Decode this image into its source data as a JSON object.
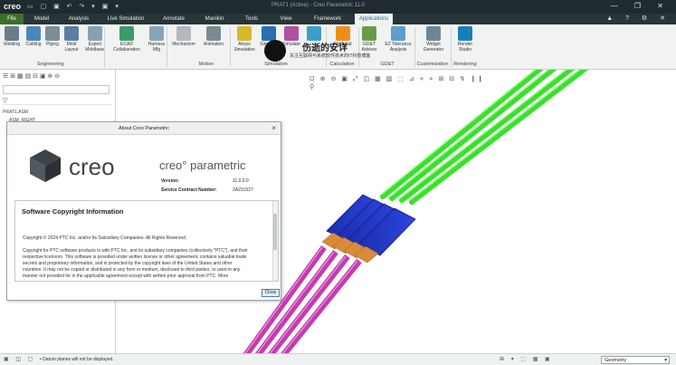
{
  "titlebar": {
    "logo": "creo",
    "window_title": "PRAT1 (Active) - Creo Parametric 11.0",
    "quick_access": "▭ ▢ ▣ ↶ ↷ ▾ ▣ ▾"
  },
  "menu": {
    "tabs": [
      "File",
      "Model",
      "Analysis",
      "Live Simulation",
      "Annotate",
      "Manikin",
      "Tools",
      "View",
      "Framework",
      "Applications"
    ],
    "active": "Applications",
    "help_icons": "▲ ? ⚙ ✕"
  },
  "ribbon": {
    "buttons": [
      {
        "label": "Welding",
        "color": "#6b7c8a"
      },
      {
        "label": "Cabling",
        "color": "#4c86b8"
      },
      {
        "label": "Piping",
        "color": "#7a8e98"
      },
      {
        "label": "Mold\nLayout",
        "color": "#5a7fa3"
      },
      {
        "label": "Expert\nMoldbase",
        "color": "#8aa0b0"
      },
      {
        "label": "ECAD\nCollaboration",
        "color": "#3f9a6a"
      },
      {
        "label": "Harness\nMfg",
        "color": "#88a3b8"
      },
      {
        "label": "Mechanism",
        "color": "#b3b8bd"
      },
      {
        "label": "Animation",
        "color": "#7d8a92"
      },
      {
        "label": "Ansys\nSimulation",
        "color": "#d8b92a"
      },
      {
        "label": "Simulate",
        "color": "#2a6fb0"
      },
      {
        "label": "Simulate",
        "color": "#b050a0"
      },
      {
        "label": "",
        "color": "#3aa0c8"
      },
      {
        "label": "Mathcad",
        "color": "#f08c1a"
      },
      {
        "label": "GD&T\nAdvisor",
        "color": "#6d9a46"
      },
      {
        "label": "EZ Tolerance\nAnalysis",
        "color": "#5b9fd0"
      },
      {
        "label": "Widget\nGenerator",
        "color": "#6f8596"
      },
      {
        "label": "Render\nStudio",
        "color": "#1a7fb8"
      }
    ],
    "groups": [
      "Engineering",
      "Motion",
      "Simulation",
      "Calculation",
      "GD&T",
      "Customization",
      "Rendering"
    ]
  },
  "watermark": {
    "line1": "伤逝的安详",
    "line2": "关注互联网与系统软件技术的IT科技博客"
  },
  "tree": {
    "tools": "☰ ⊞ ▦ ▤ ⊟ ▣ ⊕ ⊖",
    "filter": "▽",
    "items": [
      "PRAT1.ASM",
      "ASM_RIGHT"
    ]
  },
  "viewport_toolbar": "⊡ ⊕ ⊖ ▣ ⤢ ◫ ▦ ▧ ⬚ ⊿ ⟡ ⋄ ⊞ ⊟ ↯ ❙❙ ⚲",
  "dialog": {
    "title": "About Creo Parametric",
    "brand": "creo",
    "product": "creo° parametric",
    "version_label": "Version:",
    "version_value": "11.0.0.0",
    "contract_label": "Service Contract Number:",
    "contract_value": "2A231527",
    "section_title": "Software Copyright Information",
    "lines": [
      "Copyright © 2024 PTC Inc. and/or Its Subsidiary Companies. All Rights Reserved.",
      "Copyright for PTC software products is with PTC Inc. and its subsidiary companies (collectively \"PTC\"), and their",
      "respective licensors. This software is provided under written license or other agreement, contains valuable trade",
      "secrets and proprietary information, and is protected by the copyright laws of the United States and other",
      "countries. It may not be copied or distributed in any form or medium, disclosed to third parties, or used in any",
      "manner not provided for in the applicable agreement except with written prior approval from PTC. More"
    ],
    "close_label": "Close"
  },
  "status": {
    "message": "• Datum planes will not be displayed.",
    "filter_value": "Geometry",
    "tools": "⊞ ▾ ⬚ ▦ ▣"
  }
}
